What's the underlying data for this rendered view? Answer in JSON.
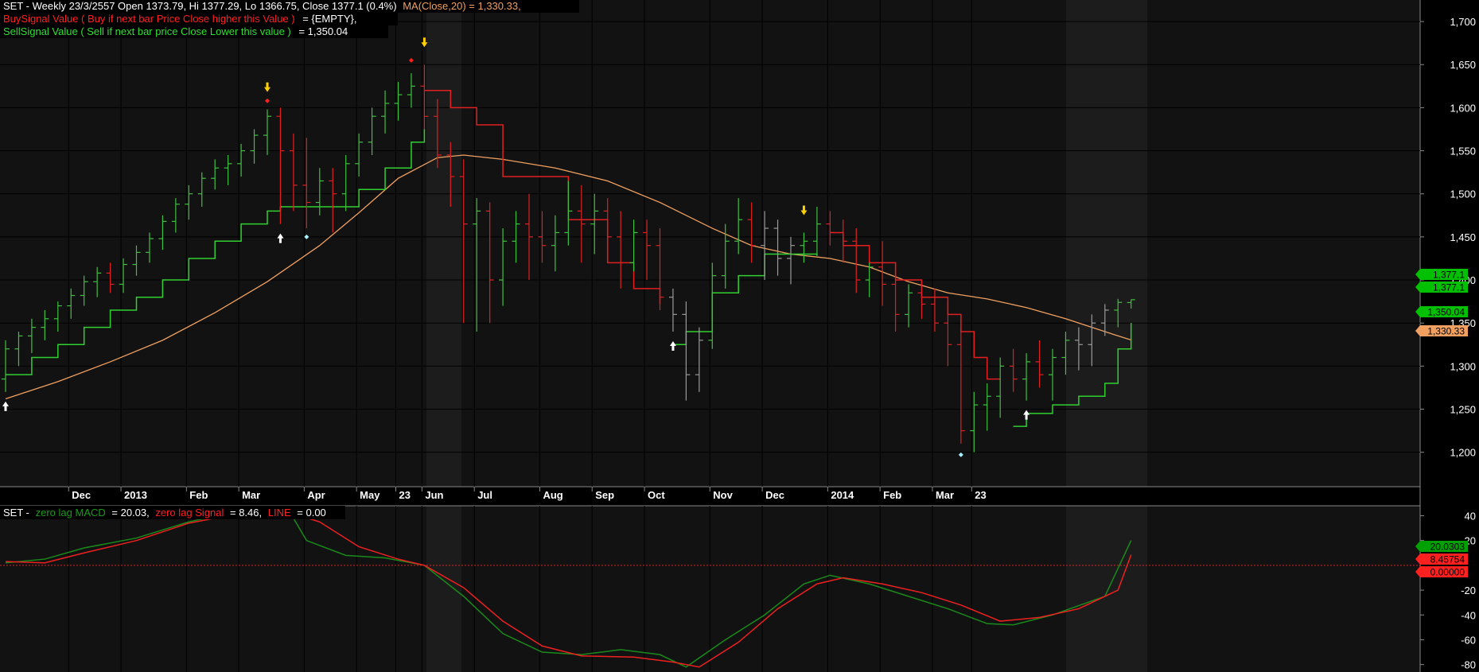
{
  "header": {
    "line1_main": "SET - Weekly 23/3/2557 Open 1373.79, Hi 1377.29, Lo 1366.75, Close 1377.1 (0.4%)",
    "line1_ma": "MA(Close,20) = 1,330.33,",
    "line2_label": "BuySignal Value ( Buy if next bar Price Close higher this Value )",
    "line2_value": "= {EMPTY},",
    "line3_label": "SellSignal Value ( Sell if next bar price Close Lower this value )",
    "line3_value": "= 1,350.04"
  },
  "macd_header": {
    "prefix": "SET -",
    "macd_label": "zero lag MACD",
    "macd_value": "= 20.03,",
    "signal_label": "zero lag Signal",
    "signal_value": "= 8.46,",
    "line_label": "LINE",
    "line_value": "= 0.00"
  },
  "price_tags": [
    {
      "text": "1,377.1",
      "color": "#00c000"
    },
    {
      "text": "1,377.1",
      "color": "#00c000"
    },
    {
      "text": "1,350.04",
      "color": "#00c000"
    },
    {
      "text": "1,330.33",
      "color": "#f0a060"
    }
  ],
  "macd_tags": [
    {
      "text": "20.0303",
      "color": "#00a000"
    },
    {
      "text": "8.45754",
      "color": "#ff2020"
    },
    {
      "text": "0.00000",
      "color": "#ff2020"
    }
  ],
  "colors": {
    "background": "#000000",
    "plot_bg": "#121212",
    "plot_bg_alt": "#1c1c1c",
    "grid": "#000000",
    "bar_up": "#40c040",
    "bar_down": "#e02020",
    "bar_neutral": "#9a9a9a",
    "ma": "#f0a060",
    "stop_green": "#30d030",
    "stop_red": "#e02020",
    "macd": "#1a8a1a",
    "signal": "#ee2020"
  },
  "chart_data": [
    {
      "type": "ohlc",
      "title": "SET - Weekly",
      "y_ticks": [
        1200,
        1250,
        1300,
        1350,
        1400,
        1450,
        1500,
        1550,
        1600,
        1650,
        1700
      ],
      "y_tick_labels": [
        "1,200",
        "1,250",
        "1,300",
        "1,350",
        "1,400",
        "1,450",
        "1,500",
        "1,550",
        "1,600",
        "1,650",
        "1,700"
      ],
      "ylim": [
        1160,
        1725
      ],
      "x_axis_labels": [
        {
          "bar": 5,
          "text": "Dec"
        },
        {
          "bar": 9,
          "text": "2013"
        },
        {
          "bar": 14,
          "text": "Feb"
        },
        {
          "bar": 18,
          "text": "Mar"
        },
        {
          "bar": 23,
          "text": "Apr"
        },
        {
          "bar": 27,
          "text": "May"
        },
        {
          "bar": 30,
          "text": "23"
        },
        {
          "bar": 32,
          "text": "Jun"
        },
        {
          "bar": 36,
          "text": "Jul"
        },
        {
          "bar": 41,
          "text": "Aug"
        },
        {
          "bar": 45,
          "text": "Sep"
        },
        {
          "bar": 49,
          "text": "Oct"
        },
        {
          "bar": 54,
          "text": "Nov"
        },
        {
          "bar": 58,
          "text": "Dec"
        },
        {
          "bar": 63,
          "text": "2014"
        },
        {
          "bar": 67,
          "text": "Feb"
        },
        {
          "bar": 71,
          "text": "Mar"
        },
        {
          "bar": 74,
          "text": "23"
        }
      ],
      "bars_ohlc": [
        [
          1285,
          1330,
          1270,
          1320
        ],
        [
          1320,
          1340,
          1300,
          1335
        ],
        [
          1335,
          1355,
          1315,
          1345
        ],
        [
          1345,
          1365,
          1330,
          1355
        ],
        [
          1355,
          1375,
          1340,
          1370
        ],
        [
          1370,
          1390,
          1355,
          1382
        ],
        [
          1382,
          1405,
          1370,
          1398
        ],
        [
          1398,
          1415,
          1380,
          1408
        ],
        [
          1408,
          1420,
          1385,
          1395
        ],
        [
          1395,
          1425,
          1385,
          1418
        ],
        [
          1418,
          1440,
          1405,
          1432
        ],
        [
          1432,
          1455,
          1420,
          1448
        ],
        [
          1448,
          1475,
          1435,
          1468
        ],
        [
          1468,
          1495,
          1455,
          1488
        ],
        [
          1488,
          1510,
          1470,
          1500
        ],
        [
          1500,
          1525,
          1485,
          1518
        ],
        [
          1518,
          1540,
          1505,
          1530
        ],
        [
          1530,
          1545,
          1510,
          1535
        ],
        [
          1535,
          1558,
          1520,
          1550
        ],
        [
          1550,
          1575,
          1535,
          1568
        ],
        [
          1568,
          1598,
          1545,
          1590
        ],
        [
          1590,
          1600,
          1465,
          1550
        ],
        [
          1550,
          1570,
          1480,
          1510
        ],
        [
          1510,
          1565,
          1460,
          1490
        ],
        [
          1490,
          1530,
          1475,
          1515
        ],
        [
          1515,
          1530,
          1455,
          1500
        ],
        [
          1500,
          1545,
          1480,
          1535
        ],
        [
          1535,
          1570,
          1520,
          1560
        ],
        [
          1560,
          1600,
          1545,
          1590
        ],
        [
          1590,
          1620,
          1570,
          1605
        ],
        [
          1605,
          1630,
          1585,
          1615
        ],
        [
          1615,
          1640,
          1600,
          1625
        ],
        [
          1625,
          1650,
          1575,
          1590
        ],
        [
          1590,
          1610,
          1530,
          1545
        ],
        [
          1545,
          1560,
          1485,
          1520
        ],
        [
          1520,
          1540,
          1350,
          1465
        ],
        [
          1465,
          1495,
          1340,
          1480
        ],
        [
          1480,
          1490,
          1350,
          1400
        ],
        [
          1400,
          1460,
          1370,
          1445
        ],
        [
          1445,
          1480,
          1420,
          1465
        ],
        [
          1465,
          1500,
          1400,
          1450
        ],
        [
          1450,
          1480,
          1420,
          1440
        ],
        [
          1440,
          1475,
          1410,
          1455
        ],
        [
          1455,
          1515,
          1440,
          1480
        ],
        [
          1480,
          1510,
          1420,
          1465
        ],
        [
          1465,
          1500,
          1430,
          1480
        ],
        [
          1480,
          1495,
          1420,
          1450
        ],
        [
          1450,
          1480,
          1390,
          1420
        ],
        [
          1420,
          1470,
          1410,
          1455
        ],
        [
          1455,
          1470,
          1400,
          1440
        ],
        [
          1440,
          1460,
          1365,
          1380
        ],
        [
          1380,
          1390,
          1340,
          1360
        ],
        [
          1360,
          1375,
          1260,
          1290
        ],
        [
          1290,
          1345,
          1270,
          1330
        ],
        [
          1330,
          1420,
          1320,
          1405
        ],
        [
          1405,
          1465,
          1390,
          1445
        ],
        [
          1445,
          1495,
          1430,
          1470
        ],
        [
          1470,
          1490,
          1420,
          1440
        ],
        [
          1440,
          1480,
          1400,
          1460
        ],
        [
          1460,
          1470,
          1405,
          1425
        ],
        [
          1425,
          1450,
          1395,
          1440
        ],
        [
          1440,
          1455,
          1420,
          1445
        ],
        [
          1445,
          1485,
          1430,
          1465
        ],
        [
          1465,
          1480,
          1440,
          1455
        ],
        [
          1455,
          1470,
          1420,
          1445
        ],
        [
          1445,
          1460,
          1385,
          1400
        ],
        [
          1400,
          1420,
          1380,
          1415
        ],
        [
          1415,
          1445,
          1370,
          1395
        ],
        [
          1395,
          1420,
          1340,
          1360
        ],
        [
          1360,
          1395,
          1345,
          1385
        ],
        [
          1385,
          1400,
          1355,
          1372
        ],
        [
          1372,
          1390,
          1340,
          1350
        ],
        [
          1350,
          1375,
          1300,
          1325
        ],
        [
          1325,
          1345,
          1210,
          1225
        ],
        [
          1225,
          1270,
          1200,
          1255
        ],
        [
          1255,
          1280,
          1225,
          1265
        ],
        [
          1265,
          1310,
          1240,
          1300
        ],
        [
          1300,
          1320,
          1270,
          1285
        ],
        [
          1285,
          1315,
          1260,
          1305
        ],
        [
          1305,
          1330,
          1275,
          1290
        ],
        [
          1290,
          1320,
          1260,
          1310
        ],
        [
          1310,
          1340,
          1290,
          1330
        ],
        [
          1330,
          1345,
          1295,
          1325
        ],
        [
          1325,
          1360,
          1300,
          1350
        ],
        [
          1350,
          1372,
          1335,
          1365
        ],
        [
          1365,
          1378,
          1345,
          1374
        ],
        [
          1373.79,
          1377.29,
          1366.75,
          1377.1
        ]
      ],
      "ma20_points": [
        [
          0,
          1262
        ],
        [
          4,
          1282
        ],
        [
          8,
          1305
        ],
        [
          12,
          1330
        ],
        [
          16,
          1362
        ],
        [
          20,
          1398
        ],
        [
          24,
          1440
        ],
        [
          27,
          1478
        ],
        [
          30,
          1518
        ],
        [
          33,
          1542
        ],
        [
          35,
          1545
        ],
        [
          38,
          1540
        ],
        [
          42,
          1530
        ],
        [
          46,
          1515
        ],
        [
          50,
          1490
        ],
        [
          54,
          1460
        ],
        [
          57,
          1440
        ],
        [
          60,
          1430
        ],
        [
          63,
          1425
        ],
        [
          66,
          1415
        ],
        [
          69,
          1398
        ],
        [
          72,
          1385
        ],
        [
          75,
          1378
        ],
        [
          78,
          1368
        ],
        [
          81,
          1355
        ],
        [
          84,
          1340
        ],
        [
          86,
          1330.33
        ]
      ],
      "stop_line_green": [
        [
          0,
          1290
        ],
        [
          2,
          1310
        ],
        [
          4,
          1325
        ],
        [
          6,
          1345
        ],
        [
          8,
          1365
        ],
        [
          10,
          1380
        ],
        [
          12,
          1400
        ],
        [
          14,
          1425
        ],
        [
          16,
          1445
        ],
        [
          18,
          1465
        ],
        [
          20,
          1480
        ],
        [
          21,
          1485
        ],
        [
          24,
          1485
        ],
        [
          27,
          1505
        ],
        [
          29,
          1530
        ],
        [
          31,
          1560
        ],
        [
          32,
          1575
        ]
      ],
      "stop_line_red": [
        [
          32,
          1620
        ],
        [
          34,
          1600
        ],
        [
          36,
          1580
        ],
        [
          38,
          1520
        ],
        [
          41,
          1520
        ],
        [
          43,
          1470
        ],
        [
          46,
          1420
        ],
        [
          48,
          1390
        ],
        [
          50,
          1372
        ]
      ],
      "stop_line_green_2": [
        [
          51,
          1325
        ],
        [
          52,
          1340
        ],
        [
          54,
          1385
        ],
        [
          56,
          1405
        ],
        [
          58,
          1430
        ],
        [
          60,
          1430
        ],
        [
          62,
          1428
        ]
      ],
      "stop_line_red_2": [
        [
          63,
          1455
        ],
        [
          64,
          1440
        ],
        [
          66,
          1420
        ],
        [
          68,
          1400
        ],
        [
          70,
          1380
        ],
        [
          72,
          1360
        ],
        [
          73,
          1340
        ],
        [
          74,
          1310
        ],
        [
          75,
          1285
        ],
        [
          76,
          1285
        ]
      ],
      "stop_line_green_3": [
        [
          77,
          1230
        ],
        [
          78,
          1245
        ],
        [
          80,
          1255
        ],
        [
          82,
          1265
        ],
        [
          84,
          1280
        ],
        [
          85,
          1320
        ],
        [
          86,
          1350.04
        ]
      ],
      "buy_arrows": [
        0,
        21,
        51,
        78
      ],
      "sell_arrows": [
        20,
        32,
        61
      ],
      "signal_dots_red": [
        [
          20,
          1608
        ],
        [
          31,
          1655
        ]
      ],
      "signal_dots_cyan": [
        [
          23,
          1450
        ],
        [
          73,
          1197
        ]
      ]
    },
    {
      "type": "line",
      "title": "zero lag MACD",
      "y_ticks": [
        40,
        20,
        -20,
        -40,
        -60,
        -80
      ],
      "y_tick_labels": [
        "40",
        "20",
        "-20",
        "-40",
        "-60",
        "-80"
      ],
      "ylim": [
        -86,
        48
      ],
      "zero_line": 0,
      "series": [
        {
          "name": "zero lag MACD",
          "color": "#1a8a1a",
          "values": [
            [
              0,
              2
            ],
            [
              3,
              5
            ],
            [
              6,
              14
            ],
            [
              10,
              22
            ],
            [
              14,
              35
            ],
            [
              18,
              44
            ],
            [
              20,
              45
            ],
            [
              22,
              38
            ],
            [
              23,
              20
            ],
            [
              26,
              8
            ],
            [
              29,
              6
            ],
            [
              32,
              0
            ],
            [
              35,
              -25
            ],
            [
              38,
              -55
            ],
            [
              41,
              -70
            ],
            [
              44,
              -72
            ],
            [
              47,
              -68
            ],
            [
              50,
              -72
            ],
            [
              52,
              -82
            ],
            [
              55,
              -60
            ],
            [
              58,
              -40
            ],
            [
              61,
              -15
            ],
            [
              63,
              -8
            ],
            [
              66,
              -15
            ],
            [
              69,
              -25
            ],
            [
              72,
              -35
            ],
            [
              75,
              -47
            ],
            [
              77,
              -48
            ],
            [
              80,
              -40
            ],
            [
              84,
              -25
            ],
            [
              86,
              20.03
            ]
          ]
        },
        {
          "name": "zero lag Signal",
          "color": "#ee2020",
          "values": [
            [
              0,
              3
            ],
            [
              3,
              2
            ],
            [
              6,
              10
            ],
            [
              10,
              20
            ],
            [
              14,
              34
            ],
            [
              18,
              42
            ],
            [
              21,
              45
            ],
            [
              24,
              35
            ],
            [
              27,
              15
            ],
            [
              30,
              5
            ],
            [
              32,
              0
            ],
            [
              35,
              -18
            ],
            [
              38,
              -45
            ],
            [
              41,
              -65
            ],
            [
              44,
              -73
            ],
            [
              48,
              -74
            ],
            [
              51,
              -78
            ],
            [
              53,
              -82
            ],
            [
              56,
              -62
            ],
            [
              59,
              -35
            ],
            [
              62,
              -15
            ],
            [
              64,
              -10
            ],
            [
              67,
              -15
            ],
            [
              70,
              -22
            ],
            [
              73,
              -32
            ],
            [
              76,
              -45
            ],
            [
              79,
              -42
            ],
            [
              82,
              -35
            ],
            [
              85,
              -20
            ],
            [
              86,
              8.46
            ]
          ]
        }
      ]
    }
  ]
}
